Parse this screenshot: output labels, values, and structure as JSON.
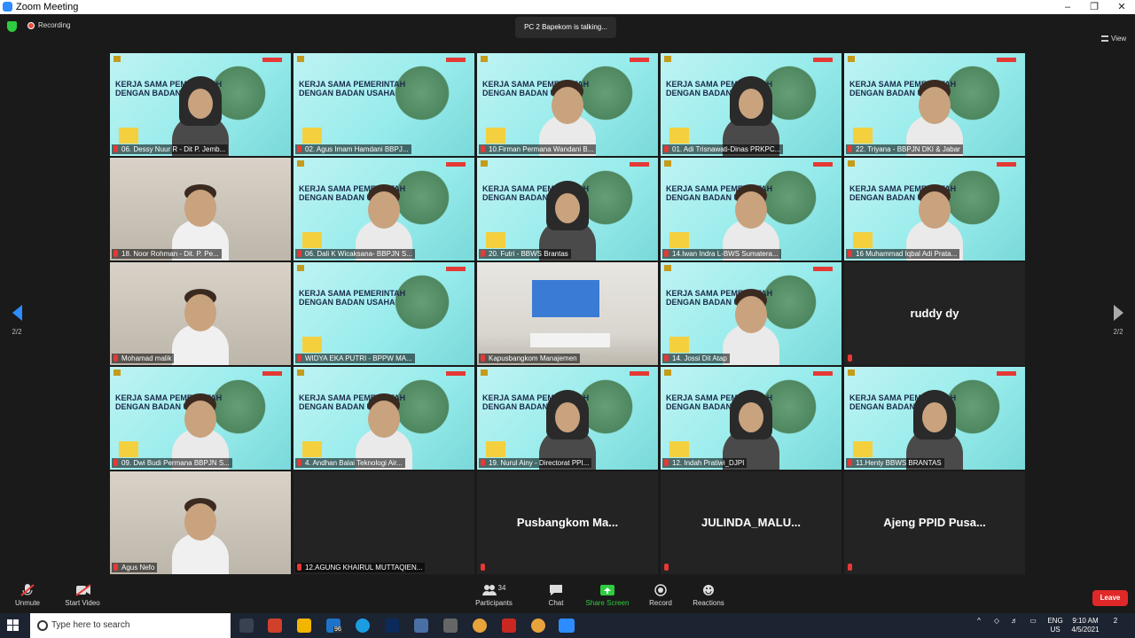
{
  "window": {
    "title": "Zoom Meeting",
    "min": "‒",
    "max": "❐",
    "close": "✕"
  },
  "topbar": {
    "recording": "Recording",
    "talking": "PC 2 Bapekom is talking...",
    "view": "View"
  },
  "nav": {
    "page": "2/2"
  },
  "banner": {
    "line1": "KERJA SAMA PEMERINTAH",
    "line2": "DENGAN BADAN USAHA"
  },
  "tiles": [
    {
      "name": "06. Dessy Nuur R - Dit P. Jemb...",
      "kind": "slide-hijab"
    },
    {
      "name": "02. Agus Imam Hamdani BBPJ...",
      "kind": "slide"
    },
    {
      "name": "10.Firman Permana Wandani B...",
      "kind": "slide-person"
    },
    {
      "name": "01. Adi Trisnawati-Dinas PRKPC...",
      "kind": "slide-hijab"
    },
    {
      "name": "22. Triyana - BBPJN DKI & Jabar",
      "kind": "slide-person"
    },
    {
      "name": "18. Noor Rohman - Dit. P. Pe...",
      "kind": "photo"
    },
    {
      "name": "06. Dali K Wicaksana- BBPJN S...",
      "kind": "slide-person"
    },
    {
      "name": "20. Futri - BBWS Brantas",
      "kind": "slide-hijab"
    },
    {
      "name": "14.Iwan Indra L-BWS Sumatera...",
      "kind": "slide-person"
    },
    {
      "name": "16 Muhammad Iqbal Adi Prata...",
      "kind": "slide-person"
    },
    {
      "name": "Mohamad malik",
      "kind": "photo"
    },
    {
      "name": "WIDYA EKA PUTRI - BPPW MA...",
      "kind": "slide"
    },
    {
      "name": "Kapusbangkom Manajemen",
      "kind": "office"
    },
    {
      "name": "14. Jossi Dit Atap",
      "kind": "slide-person"
    },
    {
      "name": "ruddy dy",
      "kind": "name"
    },
    {
      "name": "09. Dwi Budi Permana BBPJN S...",
      "kind": "slide-person"
    },
    {
      "name": "4. Andhan Balai Teknologi Air...",
      "kind": "slide-person"
    },
    {
      "name": "19. Nurul Ainy - Directorat PPI...",
      "kind": "slide-hijab"
    },
    {
      "name": "12. Indah Pratiwi_DJPI",
      "kind": "slide-hijab"
    },
    {
      "name": "11.Henty BBWS BRANTAS",
      "kind": "slide-hijab"
    },
    {
      "name": "Agus Nefo",
      "kind": "photo"
    },
    {
      "name": "12.AGUNG KHAIRUL MUTTAQIEN...",
      "kind": "blank"
    },
    {
      "name": "Pusbangkom Ma...",
      "kind": "name"
    },
    {
      "name": "JULINDA_MALU...",
      "kind": "name"
    },
    {
      "name": "Ajeng PPID Pusa...",
      "kind": "name"
    }
  ],
  "toolbar": {
    "unmute": "Unmute",
    "start_video": "Start Video",
    "participants": "Participants",
    "participants_count": "34",
    "chat": "Chat",
    "share_screen": "Share Screen",
    "record": "Record",
    "reactions": "Reactions",
    "leave": "Leave"
  },
  "taskbar": {
    "search_placeholder": "Type here to search",
    "mail_badge": "96",
    "lang1": "ENG",
    "lang2": "US",
    "time": "9:10 AM",
    "date": "4/5/2021",
    "notif": "2"
  }
}
